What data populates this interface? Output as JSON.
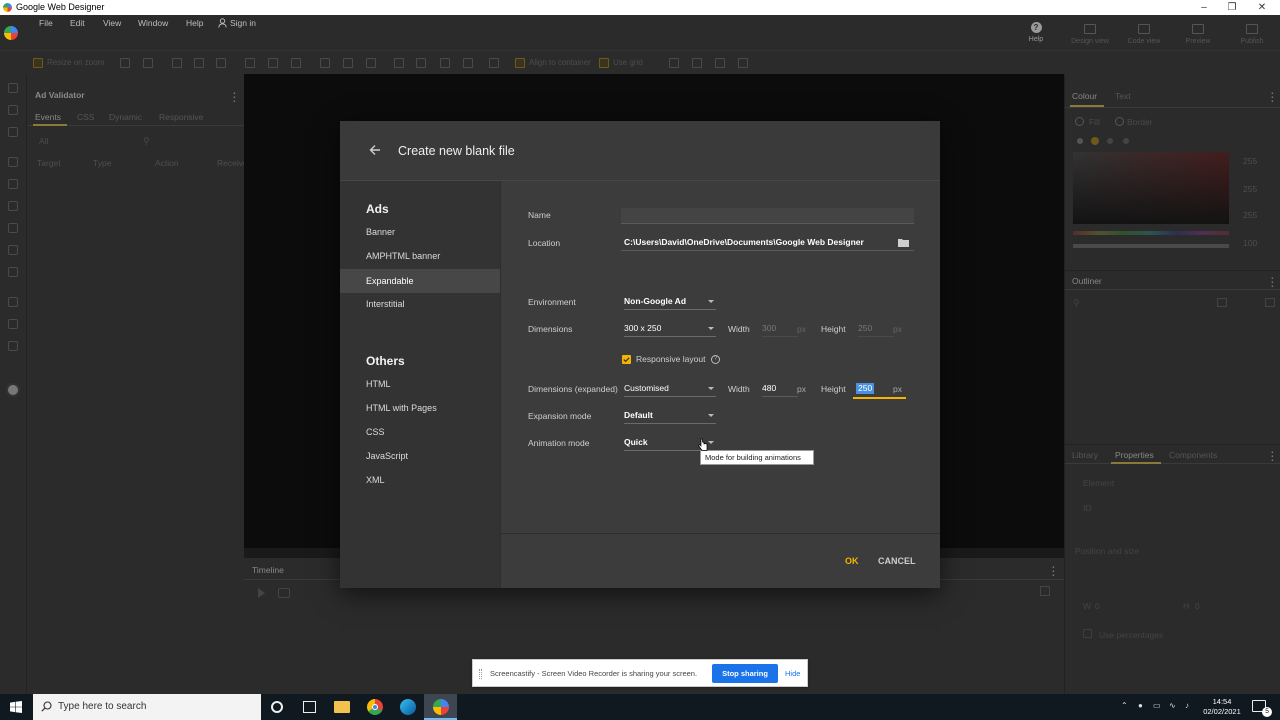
{
  "app": {
    "title": "Google Web Designer"
  },
  "menubar": {
    "items": [
      "File",
      "Edit",
      "View",
      "Window",
      "Help"
    ],
    "sign_in": "Sign in",
    "right_buttons": [
      "Help",
      "Design view",
      "Code view",
      "Preview",
      "Publish"
    ]
  },
  "toolbar": {
    "responsive_toggle": "Resize on zoom",
    "align_to_container": "Align to container",
    "grid_options": "Use grid"
  },
  "left_panel": {
    "title": "Ad Validator",
    "tabs": [
      "Events",
      "CSS",
      "Dynamic",
      "Responsive"
    ],
    "filter_value": "All",
    "columns": [
      "Target",
      "Type",
      "Action",
      "Receiver"
    ]
  },
  "timeline": {
    "title": "Timeline"
  },
  "right_panel": {
    "colour_tabs": [
      "Colour",
      "Text"
    ],
    "fill_label": "Fill",
    "border_label": "Border",
    "rgb_values": [
      "255",
      "255",
      "255",
      "100"
    ],
    "outliner_title": "Outliner",
    "bottom_tabs": [
      "Library",
      "Properties",
      "Components"
    ],
    "element_label": "Element",
    "id_label": "ID",
    "position_label": "Position and size",
    "w_label": "W",
    "w_value": "0",
    "h_label": "H",
    "h_value": "0",
    "use_percentages": "Use percentages"
  },
  "dialog": {
    "title": "Create new blank file",
    "sections": [
      {
        "heading": "Ads",
        "items": [
          "Banner",
          "AMPHTML banner",
          "Expandable",
          "Interstitial"
        ]
      },
      {
        "heading": "Others",
        "items": [
          "HTML",
          "HTML with Pages",
          "CSS",
          "JavaScript",
          "XML"
        ]
      }
    ],
    "selected_item": "Expandable",
    "name_label": "Name",
    "name_value": "",
    "location_label": "Location",
    "location_value": "C:\\Users\\David\\OneDrive\\Documents\\Google Web Designer",
    "environment_label": "Environment",
    "environment_value": "Non-Google Ad",
    "dimensions_label": "Dimensions",
    "dimensions_value": "300 x 250",
    "width_label": "Width",
    "height_label": "Height",
    "px_label": "px",
    "collapsed_width": "300",
    "collapsed_height": "250",
    "responsive_label": "Responsive layout",
    "responsive_checked": true,
    "expanded_label": "Dimensions (expanded)",
    "expanded_value": "Customised",
    "expanded_width": "480",
    "expanded_height": "250",
    "expansion_mode_label": "Expansion mode",
    "expansion_mode_value": "Default",
    "animation_mode_label": "Animation mode",
    "animation_mode_value": "Quick",
    "ok_label": "OK",
    "cancel_label": "CANCEL",
    "tooltip": "Mode for building animations"
  },
  "share_bar": {
    "message": "Screencastify - Screen Video Recorder is sharing your screen.",
    "stop_label": "Stop sharing",
    "hide_label": "Hide"
  },
  "taskbar": {
    "search_placeholder": "Type here to search",
    "time": "14:54",
    "date": "02/02/2021",
    "notification_count": "5"
  },
  "colors": {
    "accent": "#f4b400",
    "dialog_bg": "#3c3c3c",
    "share_blue": "#1a73e8"
  }
}
